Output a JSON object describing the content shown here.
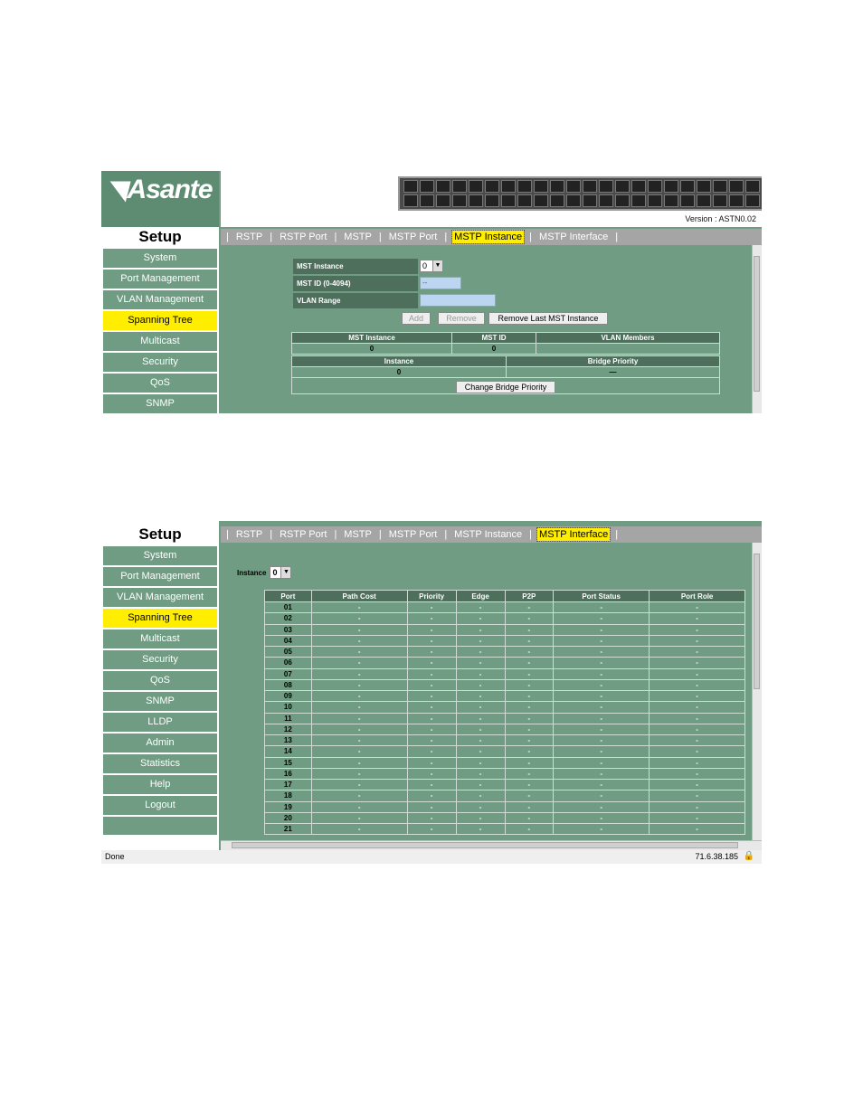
{
  "brand": {
    "logo": "Asante",
    "version_label": "Version :",
    "version_value": "ASTN0.02"
  },
  "sidebar_title": "Setup",
  "nav_short": [
    "System",
    "Port Management",
    "VLAN Management",
    "Spanning Tree",
    "Multicast",
    "Security",
    "QoS",
    "SNMP"
  ],
  "nav_full": [
    "System",
    "Port Management",
    "VLAN Management",
    "Spanning Tree",
    "Multicast",
    "Security",
    "QoS",
    "SNMP",
    "LLDP",
    "Admin",
    "Statistics",
    "Help",
    "Logout"
  ],
  "nav_active": "Spanning Tree",
  "tabs": [
    "RSTP",
    "RSTP Port",
    "MSTP",
    "MSTP Port",
    "MSTP Instance",
    "MSTP Interface"
  ],
  "shot1": {
    "active_tab": "MSTP Instance",
    "form": {
      "mst_instance_label": "MST Instance",
      "mst_instance_value": "0",
      "mst_id_label": "MST ID (0-4094)",
      "mst_id_value": "--",
      "vlan_range_label": "VLAN Range",
      "vlan_range_value": ""
    },
    "buttons": {
      "add": "Add",
      "remove": "Remove",
      "remove_last": "Remove Last MST Instance",
      "change_priority": "Change Bridge Priority"
    },
    "instance_table": {
      "headers": [
        "MST Instance",
        "MST ID",
        "VLAN Members"
      ],
      "row": [
        "0",
        "0",
        ""
      ]
    },
    "priority_table": {
      "headers": [
        "Instance",
        "Bridge Priority"
      ],
      "row": [
        "0",
        "—"
      ]
    }
  },
  "shot2": {
    "active_tab": "MSTP Interface",
    "instance_label": "Instance",
    "instance_value": "0",
    "headers": [
      "Port",
      "Path Cost",
      "Priority",
      "Edge",
      "P2P",
      "Port Status",
      "Port Role"
    ],
    "ports": [
      "01",
      "02",
      "03",
      "04",
      "05",
      "06",
      "07",
      "08",
      "09",
      "10",
      "11",
      "12",
      "13",
      "14",
      "15",
      "16",
      "17",
      "18",
      "19",
      "20",
      "21"
    ],
    "cell_value": "-",
    "status_left": "Done",
    "status_right": "71.6.38.185"
  }
}
